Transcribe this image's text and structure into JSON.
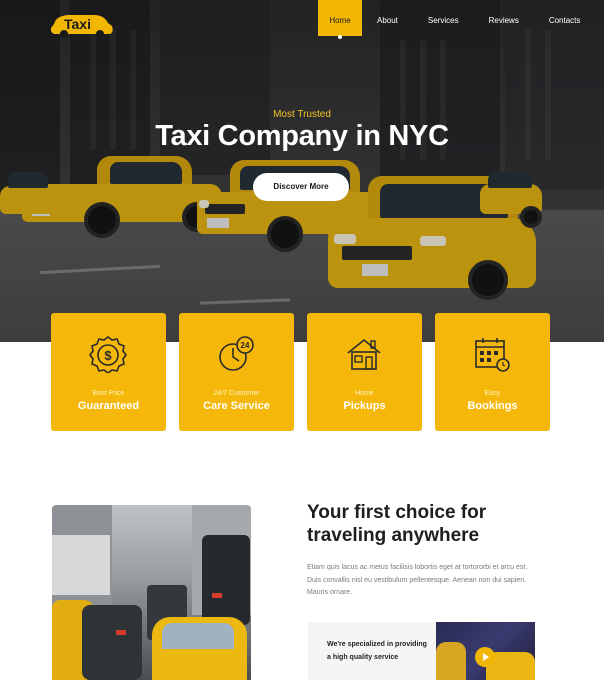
{
  "brand": {
    "name": "Taxi",
    "accent": "#f2b705"
  },
  "nav": {
    "items": [
      {
        "label": "Home",
        "active": true
      },
      {
        "label": "About",
        "active": false
      },
      {
        "label": "Services",
        "active": false
      },
      {
        "label": "Reviews",
        "active": false
      },
      {
        "label": "Contacts",
        "active": false
      }
    ]
  },
  "hero": {
    "eyebrow": "Most Trusted",
    "title": "Taxi Company in NYC",
    "cta_label": "Discover More"
  },
  "features": [
    {
      "icon": "dollar-badge-icon",
      "sub": "Best Price",
      "main": "Guaranteed"
    },
    {
      "icon": "clock-24-icon",
      "sub": "24/7 Customer",
      "main": "Care Service"
    },
    {
      "icon": "house-icon",
      "sub": "Home",
      "main": "Pickups"
    },
    {
      "icon": "calendar-icon",
      "sub": "Easy",
      "main": "Bookings"
    }
  ],
  "about": {
    "title": "Your first choice for traveling anywhere",
    "text": "Etiam quis lacus ac metus facilisis lobortis eget at tortororbi et arcu est. Duis convallis nisl eu vestibulum pellentesque. Aenean non dui sapien. Mauris ornare.",
    "specialized": "We're specialized in providing a high quality service"
  }
}
